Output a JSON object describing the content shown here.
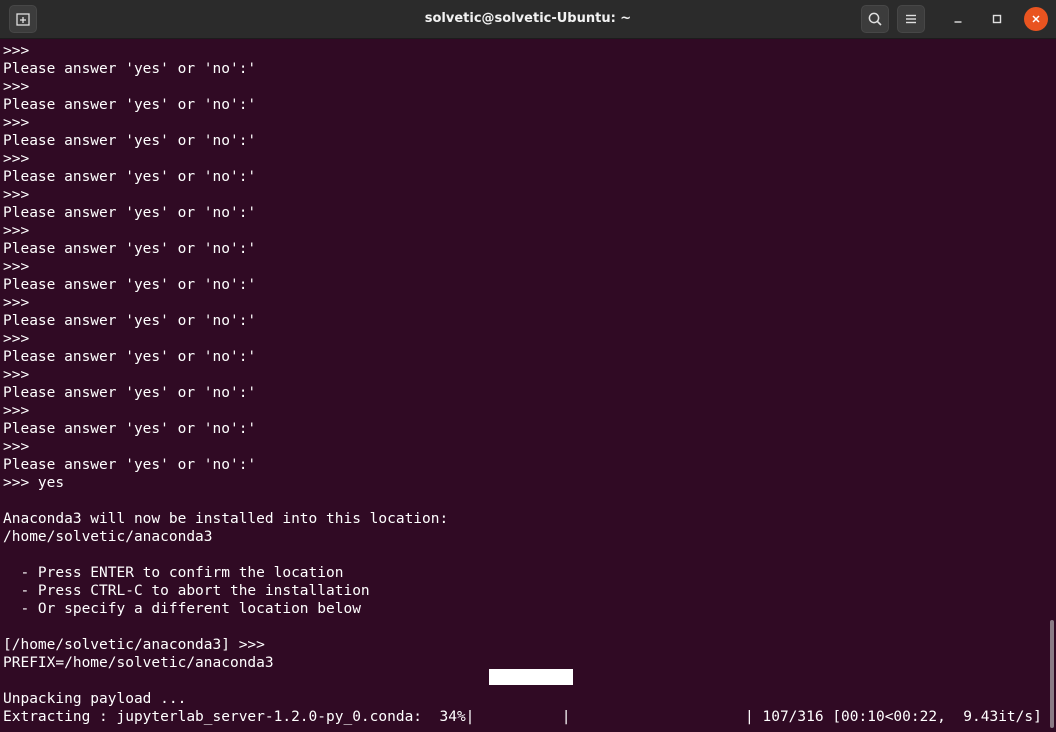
{
  "window": {
    "title": "solvetic@solvetic-Ubuntu: ~"
  },
  "icons": {
    "new_tab": "new-tab-icon",
    "search": "search-icon",
    "menu": "hamburger-menu-icon",
    "minimize": "minimize-icon",
    "maximize": "maximize-icon",
    "close": "close-icon"
  },
  "colors": {
    "terminal_background": "#300a24",
    "terminal_text": "#ffffff",
    "titlebar": "#2b2b2b",
    "close_button": "#e95420"
  },
  "terminal": {
    "lines": [
      ">>>",
      "Please answer 'yes' or 'no':'",
      ">>>",
      "Please answer 'yes' or 'no':'",
      ">>>",
      "Please answer 'yes' or 'no':'",
      ">>>",
      "Please answer 'yes' or 'no':'",
      ">>>",
      "Please answer 'yes' or 'no':'",
      ">>>",
      "Please answer 'yes' or 'no':'",
      ">>>",
      "Please answer 'yes' or 'no':'",
      ">>>",
      "Please answer 'yes' or 'no':'",
      ">>>",
      "Please answer 'yes' or 'no':'",
      ">>>",
      "Please answer 'yes' or 'no':'",
      ">>>",
      "Please answer 'yes' or 'no':'",
      ">>>",
      "Please answer 'yes' or 'no':'",
      ">>> yes",
      "",
      "Anaconda3 will now be installed into this location:",
      "/home/solvetic/anaconda3",
      "",
      "  - Press ENTER to confirm the location",
      "  - Press CTRL-C to abort the installation",
      "  - Or specify a different location below",
      "",
      "[/home/solvetic/anaconda3] >>>",
      "PREFIX=/home/solvetic/anaconda3",
      "",
      "Unpacking payload ...",
      "Extracting : jupyterlab_server-1.2.0-py_0.conda:  34%|          |                    | 107/316 [00:10<00:22,  9.43it/s]"
    ],
    "progress": {
      "percent": 34,
      "current": 107,
      "total": 316
    }
  }
}
